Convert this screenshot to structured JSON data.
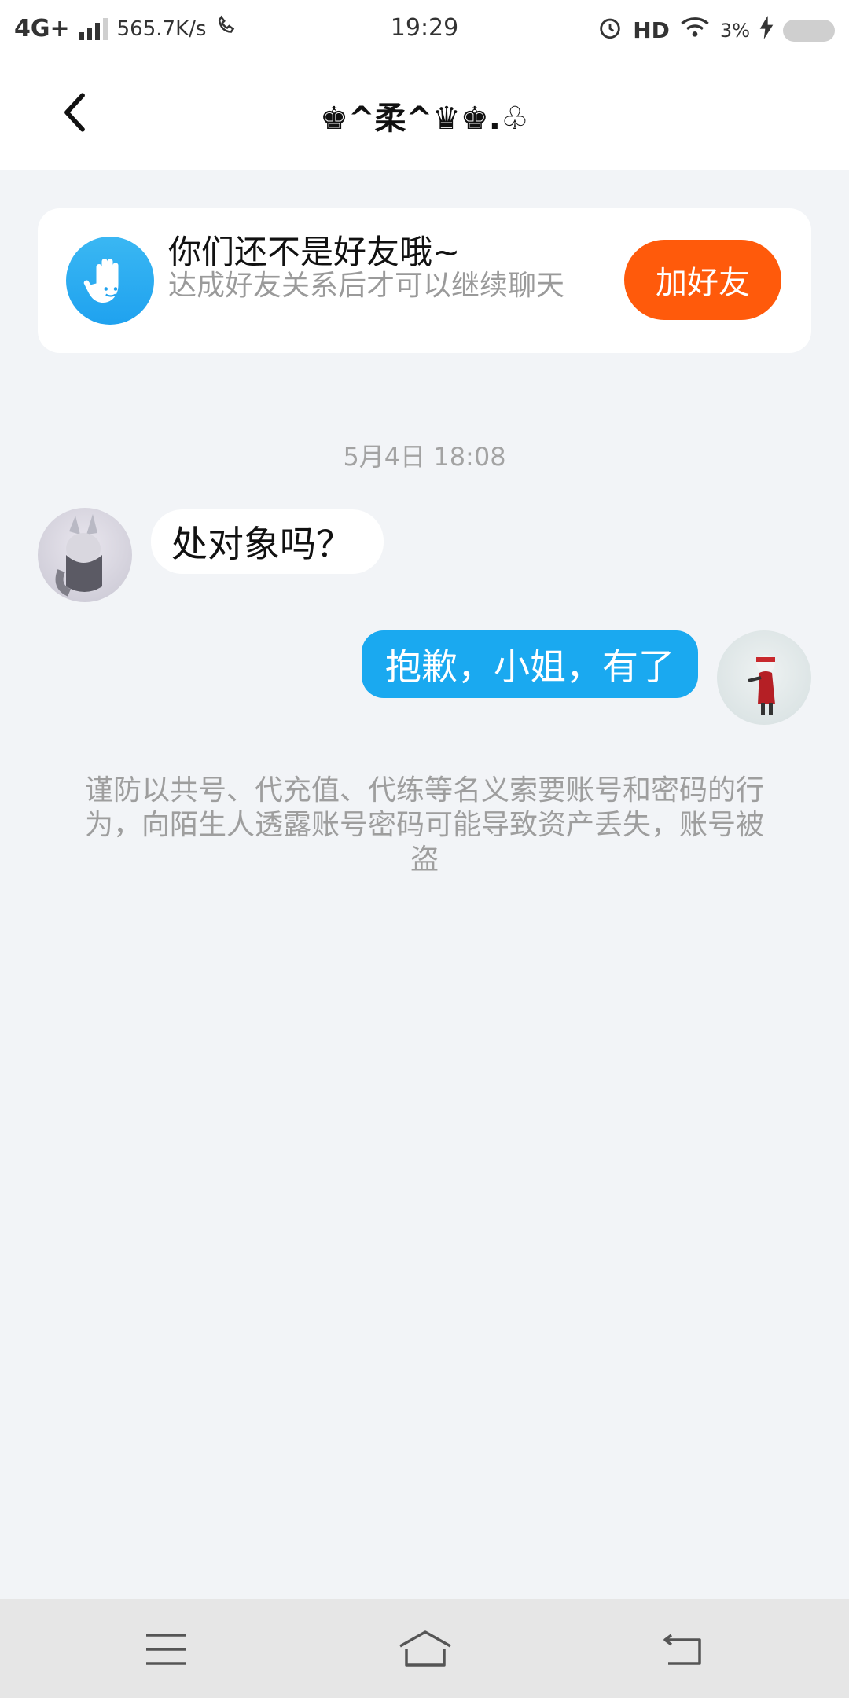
{
  "status_bar": {
    "network": "4G+",
    "speed": "565.7K/s",
    "time": "19:29",
    "hd_label": "HD",
    "battery_percent": "3%"
  },
  "header": {
    "title": "♚^柔^♛♚.♧"
  },
  "notice": {
    "title": "你们还不是好友哦~",
    "subtitle": "达成好友关系后才可以继续聊天",
    "button_label": "加好友",
    "icon": "hand-icon",
    "accent_color": "#ff5a0b"
  },
  "chat": {
    "timestamp": "5月4日 18:08",
    "messages": [
      {
        "direction": "incoming",
        "text": "处对象吗？"
      },
      {
        "direction": "outgoing",
        "text": "抱歉，小姐，有了"
      }
    ],
    "warning": "谨防以共号、代充值、代练等名义索要账号和密码的行为，向陌生人透露账号密码可能导致资产丢失，账号被盗"
  },
  "colors": {
    "outgoing_bubble": "#1aa9f0",
    "background": "#f2f4f7"
  }
}
